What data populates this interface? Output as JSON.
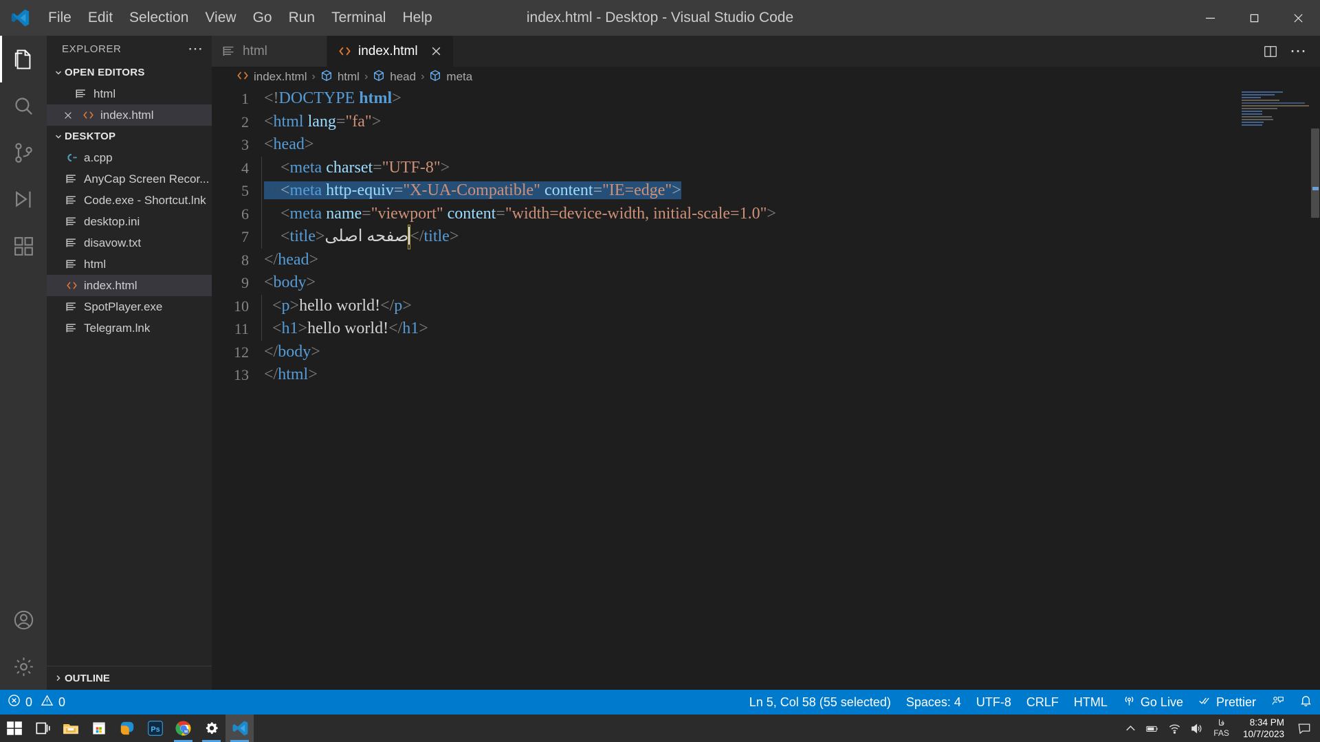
{
  "titlebar": {
    "logo_icon": "vscode-logo-icon",
    "menus": [
      "File",
      "Edit",
      "Selection",
      "View",
      "Go",
      "Run",
      "Terminal",
      "Help"
    ],
    "window_title": "index.html - Desktop - Visual Studio Code",
    "controls": {
      "minimize": "minimize-icon",
      "maximize": "maximize-icon",
      "close": "close-icon"
    }
  },
  "activitybar": {
    "items": [
      {
        "name": "explorer",
        "icon": "files-icon",
        "active": true
      },
      {
        "name": "search",
        "icon": "search-icon",
        "active": false
      },
      {
        "name": "source-control",
        "icon": "source-control-icon",
        "active": false
      },
      {
        "name": "run-and-debug",
        "icon": "run-debug-icon",
        "active": false
      },
      {
        "name": "extensions",
        "icon": "extensions-icon",
        "active": false
      }
    ],
    "bottom": [
      {
        "name": "accounts",
        "icon": "account-icon"
      },
      {
        "name": "manage",
        "icon": "gear-icon"
      }
    ]
  },
  "sidebar": {
    "header": "EXPLORER",
    "header_actions_icon": "ellipsis-icon",
    "open_editors": {
      "title": "OPEN EDITORS",
      "expanded": true,
      "items": [
        {
          "label": "html",
          "icon": "text-file-icon",
          "selected": false,
          "has_close": false
        },
        {
          "label": "index.html",
          "icon": "html-file-icon",
          "selected": true,
          "has_close": true
        }
      ]
    },
    "folder": {
      "title": "DESKTOP",
      "expanded": true,
      "items": [
        {
          "label": "a.cpp",
          "icon": "cpp-file-icon",
          "selected": false
        },
        {
          "label": "AnyCap Screen Recor...",
          "icon": "text-file-icon",
          "selected": false
        },
        {
          "label": "Code.exe - Shortcut.lnk",
          "icon": "text-file-icon",
          "selected": false
        },
        {
          "label": "desktop.ini",
          "icon": "text-file-icon",
          "selected": false
        },
        {
          "label": "disavow.txt",
          "icon": "text-file-icon",
          "selected": false
        },
        {
          "label": "html",
          "icon": "text-file-icon",
          "selected": false
        },
        {
          "label": "index.html",
          "icon": "html-file-icon",
          "selected": true
        },
        {
          "label": "SpotPlayer.exe",
          "icon": "text-file-icon",
          "selected": false
        },
        {
          "label": "Telegram.lnk",
          "icon": "text-file-icon",
          "selected": false
        }
      ]
    },
    "outline": {
      "title": "OUTLINE",
      "expanded": false
    }
  },
  "tabs": {
    "items": [
      {
        "label": "html",
        "icon": "text-file-icon",
        "active": false,
        "closable": false
      },
      {
        "label": "index.html",
        "icon": "html-file-icon",
        "active": true,
        "closable": true
      }
    ],
    "actions": [
      {
        "name": "split-editor",
        "icon": "split-editor-icon"
      },
      {
        "name": "more-actions",
        "icon": "ellipsis-icon"
      }
    ]
  },
  "breadcrumbs": {
    "items": [
      {
        "label": "index.html",
        "icon": "html-file-icon"
      },
      {
        "label": "html",
        "icon": "symbol-cube-icon"
      },
      {
        "label": "head",
        "icon": "symbol-cube-icon"
      },
      {
        "label": "meta",
        "icon": "symbol-cube-icon"
      }
    ],
    "separator": "›"
  },
  "editor": {
    "language": "HTML",
    "lines": [
      {
        "n": 1,
        "text": "<!DOCTYPE html>"
      },
      {
        "n": 2,
        "text": "<html lang=\"fa\">"
      },
      {
        "n": 3,
        "text": "<head>"
      },
      {
        "n": 4,
        "text": "    <meta charset=\"UTF-8\">"
      },
      {
        "n": 5,
        "text": "    <meta http-equiv=\"X-UA-Compatible\" content=\"IE=edge\">",
        "selected": true
      },
      {
        "n": 6,
        "text": "    <meta name=\"viewport\" content=\"width=device-width, initial-scale=1.0\">"
      },
      {
        "n": 7,
        "text": "    <title>صفحه اصلی</title>"
      },
      {
        "n": 8,
        "text": "</head>"
      },
      {
        "n": 9,
        "text": "<body>"
      },
      {
        "n": 10,
        "text": "  <p>hello world!</p>"
      },
      {
        "n": 11,
        "text": "  <h1>hello world!</h1>"
      },
      {
        "n": 12,
        "text": "</body>"
      },
      {
        "n": 13,
        "text": "</html>"
      }
    ],
    "title_text_fa": "صفحه اصلی"
  },
  "statusbar": {
    "errors_icon": "error-circle-icon",
    "errors": "0",
    "warnings_icon": "warning-triangle-icon",
    "warnings": "0",
    "cursor_position": "Ln 5, Col 58 (55 selected)",
    "indentation": "Spaces: 4",
    "encoding": "UTF-8",
    "eol": "CRLF",
    "language_mode": "HTML",
    "go_live": "Go Live",
    "go_live_icon": "broadcast-icon",
    "prettier": "Prettier",
    "prettier_icon": "double-check-icon",
    "feedback_icon": "feedback-person-icon",
    "bell_icon": "bell-icon",
    "accent_color": "#007acc"
  },
  "taskbar": {
    "items": [
      {
        "name": "start",
        "icon": "windows-start-icon",
        "running": false,
        "active": false
      },
      {
        "name": "task-view",
        "icon": "task-view-icon",
        "running": false,
        "active": false
      },
      {
        "name": "file-explorer",
        "icon": "folder-icon",
        "running": false,
        "active": false
      },
      {
        "name": "microsoft-store",
        "icon": "store-icon",
        "running": false,
        "active": false
      },
      {
        "name": "vmware",
        "icon": "vmware-icon",
        "running": false,
        "active": false
      },
      {
        "name": "photoshop",
        "icon": "photoshop-icon",
        "running": false,
        "active": false
      },
      {
        "name": "chrome",
        "icon": "chrome-icon",
        "running": true,
        "active": false
      },
      {
        "name": "settings",
        "icon": "gear-icon",
        "running": true,
        "active": false
      },
      {
        "name": "visual-studio-code",
        "icon": "vscode-logo-icon",
        "running": true,
        "active": true
      }
    ],
    "tray": {
      "show_hidden_icon": "chevron-up-icon",
      "battery_icon": "battery-icon",
      "network_icon": "wifi-icon",
      "volume_icon": "speaker-icon",
      "language_top": "فا",
      "language_bottom": "FAS",
      "time": "8:34 PM",
      "date": "10/7/2023",
      "notifications_icon": "notification-icon"
    }
  }
}
